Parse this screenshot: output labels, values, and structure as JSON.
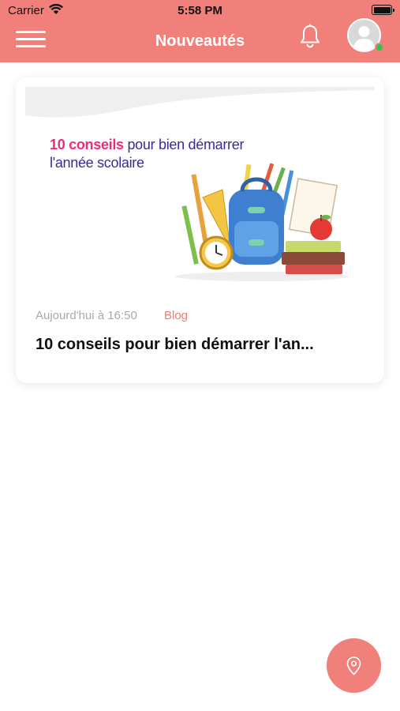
{
  "status_bar": {
    "carrier": "Carrier",
    "time": "5:58 PM",
    "battery_level": 1.0
  },
  "header": {
    "title": "Nouveautés",
    "menu_icon": "hamburger-menu-icon",
    "notification_icon": "bell-icon",
    "avatar_icon": "user-avatar",
    "online_status_color": "#35c24a",
    "background_color": "#f2807a"
  },
  "feed": {
    "items": [
      {
        "image_text_highlight": "10 conseils",
        "image_text_rest": " pour bien démarrer l'année scolaire",
        "date": "Aujourd'hui à 16:50",
        "category": "Blog",
        "title": "10 conseils pour bien démarrer l'an..."
      }
    ]
  },
  "fab": {
    "icon": "location-pin-icon"
  },
  "colors": {
    "accent": "#f2807a",
    "headline_pink": "#ea2f78",
    "headline_purple": "#3b2b8f"
  }
}
